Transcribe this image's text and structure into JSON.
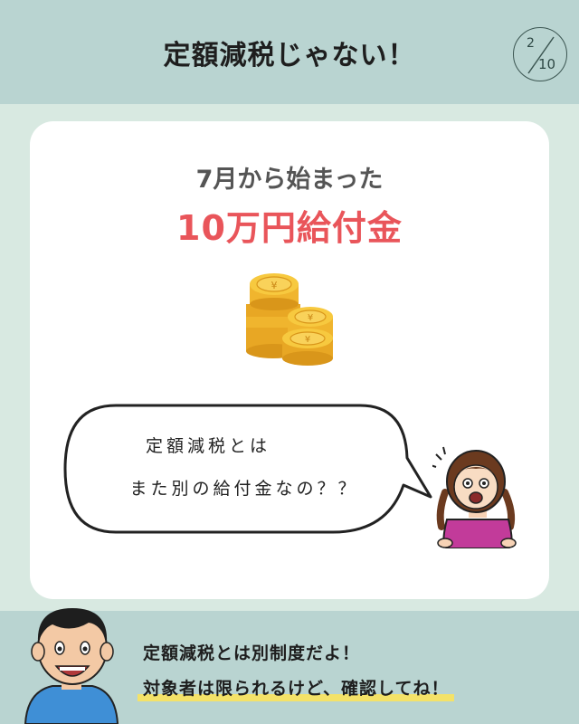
{
  "header": {
    "title": "定額減税じゃない！",
    "page": {
      "current": "2",
      "total": "10"
    }
  },
  "card": {
    "subtitle": "7月から始まった",
    "title": "10万円給付金",
    "bubble": {
      "line1": "定額減税とは",
      "line2": "また別の給付金なの？？"
    }
  },
  "footer": {
    "line1": "定額減税とは別制度だよ！",
    "line2": "対象者は限られるけど、確認してね！"
  },
  "colors": {
    "header_bg": "#b9d4d1",
    "page_bg": "#d8e9e1",
    "title_accent": "#e9555a",
    "highlight": "#f4e268"
  }
}
